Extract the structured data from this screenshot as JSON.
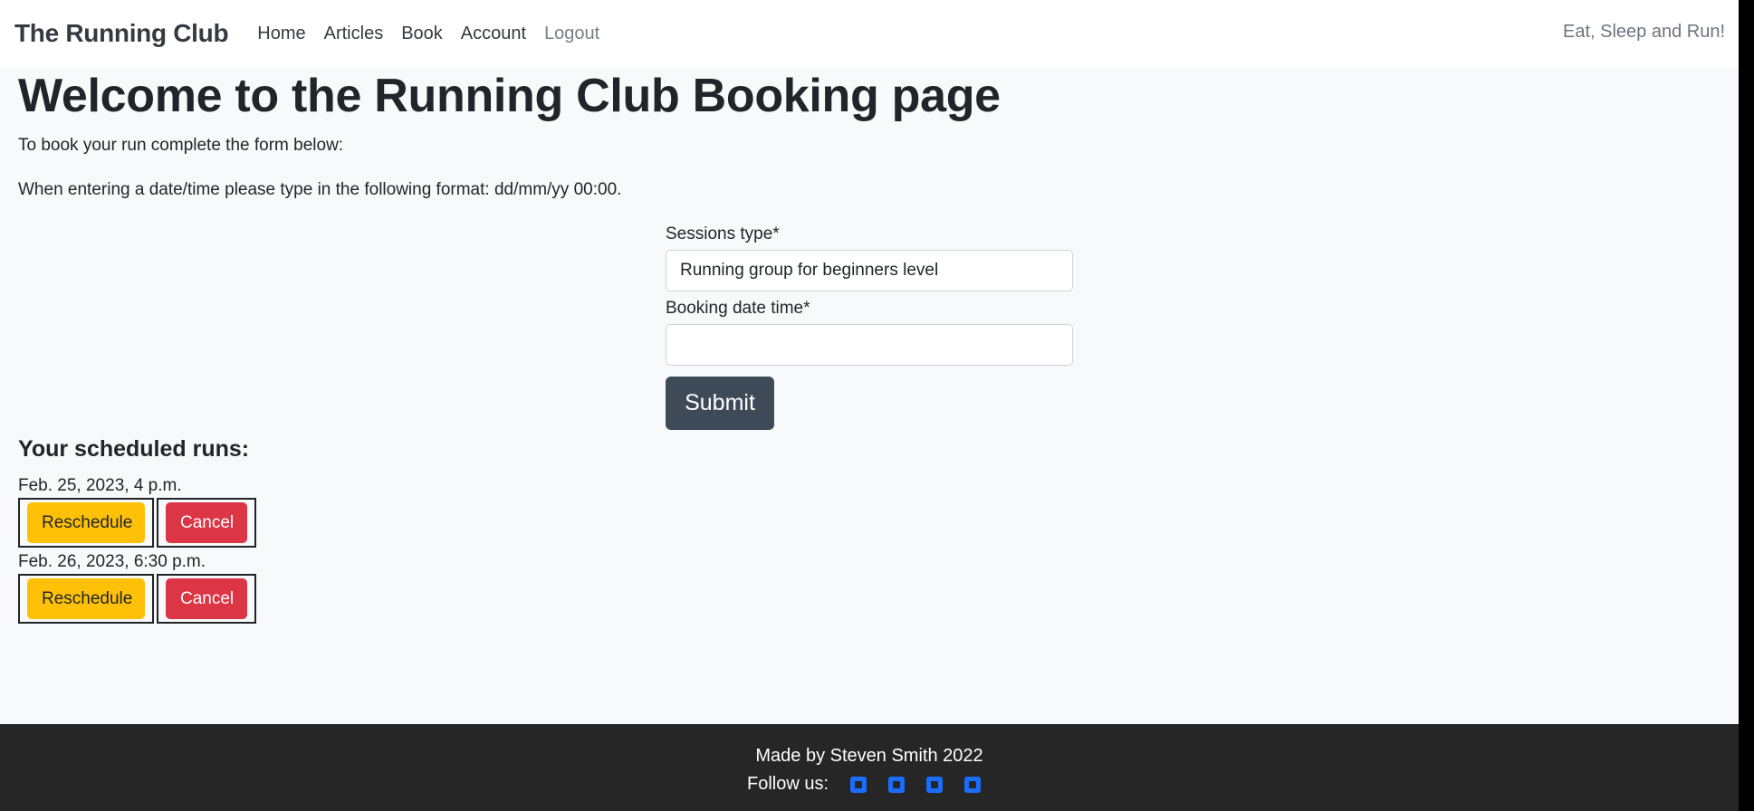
{
  "navbar": {
    "brand": "The Running Club",
    "links": [
      "Home",
      "Articles",
      "Book",
      "Account",
      "Logout"
    ],
    "tagline": "Eat, Sleep and Run!"
  },
  "main": {
    "title": "Welcome to the Running Club Booking page",
    "intro1": "To book your run complete the form below:",
    "intro2": "When entering a date/time please type in the following format: dd/mm/yy 00:00."
  },
  "form": {
    "session_label": "Sessions type*",
    "session_value": "Running group for beginners level",
    "date_label": "Booking date time*",
    "date_value": "",
    "submit_label": "Submit"
  },
  "runs": {
    "title": "Your scheduled runs:",
    "items": [
      {
        "date": "Feb. 25, 2023, 4 p.m.",
        "reschedule": "Reschedule",
        "cancel": "Cancel"
      },
      {
        "date": "Feb. 26, 2023, 6:30 p.m.",
        "reschedule": "Reschedule",
        "cancel": "Cancel"
      }
    ]
  },
  "footer": {
    "made_by": "Made by Steven Smith 2022",
    "follow": "Follow us:",
    "social_icons": [
      "facebook-icon",
      "twitter-icon",
      "instagram-icon",
      "youtube-icon"
    ],
    "icon_color": "#1a6dfd"
  }
}
